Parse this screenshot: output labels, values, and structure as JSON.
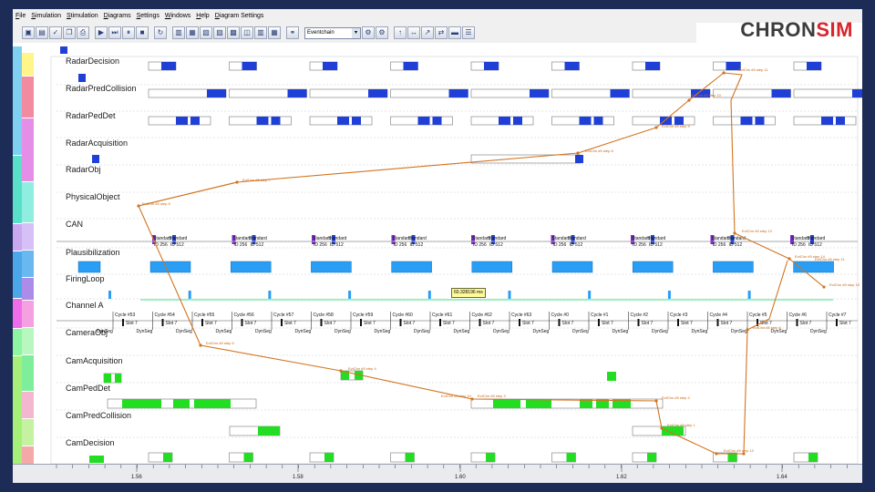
{
  "menu": [
    "File",
    "Simulation",
    "Stimulation",
    "Diagrams",
    "Settings",
    "Windows",
    "Help",
    "Diagram Settings"
  ],
  "toolbar": {
    "dropdown_value": "Eventchain"
  },
  "logo": {
    "part1": "CHRON",
    "part2": "SIM"
  },
  "colors": {
    "accent": "#1f3fd6",
    "green": "#22dd22",
    "orange": "#d2741f",
    "cyan": "#2a9df4",
    "brand_red": "#d8262c"
  },
  "lanes": [
    "RadarDecision",
    "RadarPredCollision",
    "RadarPedDet",
    "RadarAcquisition",
    "RadarObj",
    "PhysicalObject",
    "CAN",
    "Plausibilization",
    "FiringLoop",
    "Channel A",
    "CameraObj",
    "CamAcquisition",
    "CamPedDet",
    "CamPredCollision",
    "CamDecision"
  ],
  "can_labels": {
    "standard": "Standard",
    "id": "ID 256",
    "id2": "ID 512"
  },
  "flexray": {
    "cycles": [
      "Cycle #53",
      "Cycle #54",
      "Cycle #55",
      "Cycle #56",
      "Cycle #57",
      "Cycle #58",
      "Cycle #59",
      "Cycle #60",
      "Cycle #61",
      "Cycle #62",
      "Cycle #63",
      "Cycle #0",
      "Cycle #1",
      "Cycle #2",
      "Cycle #3",
      "Cycle #4",
      "Cycle #5",
      "Cycle #6",
      "Cycle #7"
    ],
    "slot": "Slot 7",
    "dyn": "DynSeg"
  },
  "cursor_readout": "60.328196 ms",
  "axis_ticks": [
    "1.56",
    "1.58",
    "1.60",
    "1.62",
    "1.64"
  ],
  "annotations": {
    "ev1": "EvtChn #5 step 11",
    "ev2": "EvtChn #5 step 10",
    "ev3": "EvtChn #5 step 9",
    "ev4": "EvtChn #5 step 8",
    "ev5": "EvtChn #5 step 7",
    "ev6": "EvtChn #5 step 6",
    "ev7": "EvtChn #5 step 5",
    "ev8": "EvtChn #5 step 4",
    "ev9": "EvtChn #5 step 3",
    "ev10": "EvtChn #5 step 2",
    "ev11": "EvtChn #5 step 1",
    "ev12": "EvtChn #5 step 12",
    "ev13": "EvtChn #5 step 13",
    "ev14": "EvtChn #5 step 14",
    "ev15": "EvtChn #5 step 15",
    "ev16": "EvtChn #5 step 8",
    "ev17": "EvtChn #5 step 10",
    "ev18": "EvtChn #5 step 11"
  }
}
